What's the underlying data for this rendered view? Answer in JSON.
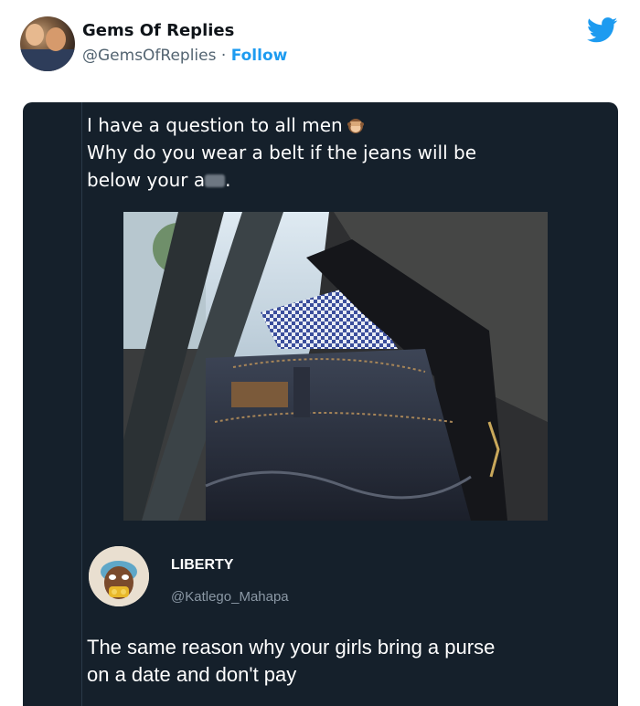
{
  "header": {
    "display_name": "Gems Of Replies",
    "handle": "@GemsOfReplies",
    "separator": " · ",
    "follow_label": "Follow",
    "brand_icon": "twitter-bird-icon",
    "brand_color": "#1d9bf0"
  },
  "embedded_post": {
    "lines": [
      "I have a question to all men",
      "Why do you wear a belt if the jeans will be",
      "below your a"
    ],
    "line3_suffix": ".",
    "emoji_icon": "monkey-covering-eyes-emoji",
    "censored_word_icon": "blurred-word",
    "photo": "photo-jeans-belt-back",
    "background_color": "#15202b"
  },
  "reply": {
    "name": "LIBERTY",
    "handle": "@Katlego_Mahapa",
    "lines": [
      "The same reason why your girls bring a purse",
      "on a date and don't pay"
    ]
  }
}
